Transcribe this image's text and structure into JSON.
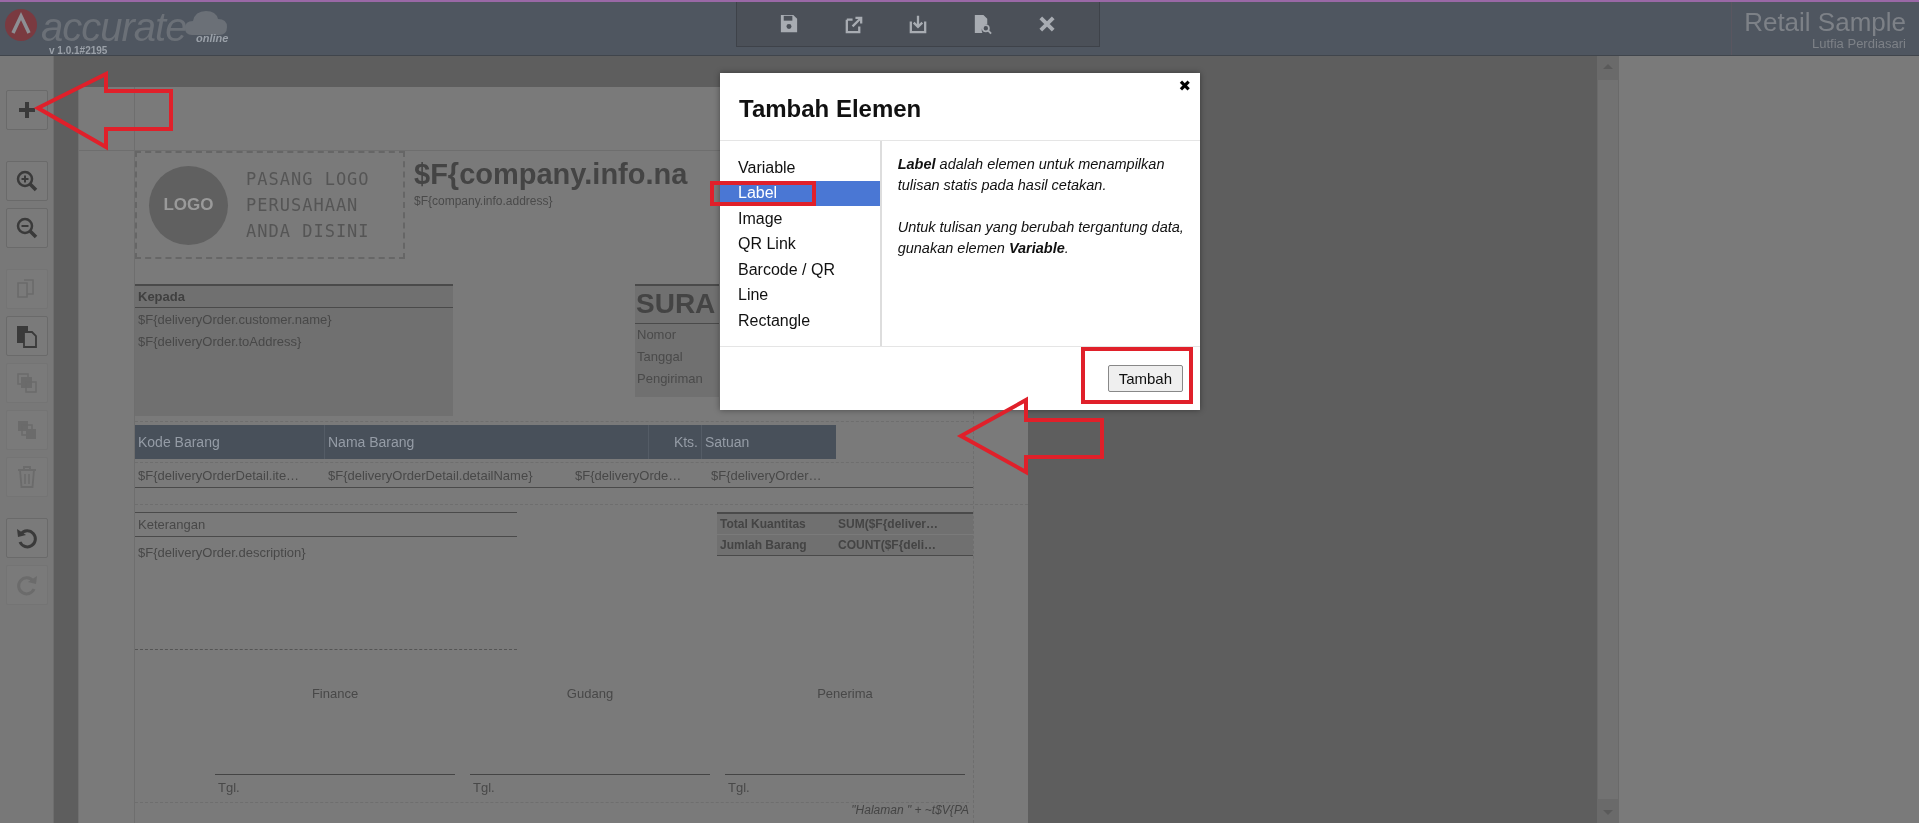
{
  "header": {
    "logo": {
      "name": "accurate",
      "tag": "online",
      "version": "v 1.0.1#2195"
    },
    "company": "Retail Sample",
    "user": "Lutfia Perdiasari"
  },
  "side_tools": [
    {
      "kind": "add",
      "disabled": false
    },
    {
      "kind": "zoom-in",
      "disabled": false
    },
    {
      "kind": "zoom-out",
      "disabled": false
    },
    {
      "kind": "copy",
      "disabled": true
    },
    {
      "kind": "paste",
      "disabled": false
    },
    {
      "kind": "front",
      "disabled": true
    },
    {
      "kind": "back",
      "disabled": true
    },
    {
      "kind": "delete",
      "disabled": true
    },
    {
      "kind": "undo",
      "disabled": false
    },
    {
      "kind": "redo",
      "disabled": true
    }
  ],
  "report": {
    "logo_placeholder": {
      "badge": "LOGO",
      "lines": [
        "PASANG LOGO",
        "PERUSAHAAN",
        "ANDA DISINI"
      ]
    },
    "company_name": "$F{company.info.na",
    "company_address": "$F{company.info.address}",
    "recipient": {
      "heading": "Kepada",
      "lines": [
        "$F{deliveryOrder.customer.name}",
        "$F{deliveryOrder.toAddress}"
      ]
    },
    "doc_title": "SURA",
    "doc_fields": [
      "Nomor",
      "Tanggal",
      "Pengiriman"
    ],
    "table": {
      "columns": [
        {
          "label": "Kode Barang"
        },
        {
          "label": "Nama Barang"
        },
        {
          "label": "Kts."
        },
        {
          "label": "Satuan"
        }
      ],
      "row": [
        "$F{deliveryOrderDetail.ite…",
        "$F{deliveryOrderDetail.detailName}",
        "$F{deliveryOrde…",
        "$F{deliveryOrder…"
      ]
    },
    "notes": {
      "heading": "Keterangan",
      "value": "$F{deliveryOrder.description}"
    },
    "totals": [
      {
        "label": "Total Kuantitas",
        "value": "SUM($F{deliver…"
      },
      {
        "label": "Jumlah Barang",
        "value": "COUNT($F{deli…"
      }
    ],
    "signatures": [
      {
        "title": "Finance",
        "date_label": "Tgl."
      },
      {
        "title": "Gudang",
        "date_label": "Tgl."
      },
      {
        "title": "Penerima",
        "date_label": "Tgl."
      }
    ],
    "footer": "\"Halaman \" + ~t$V{PA"
  },
  "dialog": {
    "title": "Tambah Elemen",
    "close": "✖",
    "items": [
      {
        "label": "Variable",
        "selected": false
      },
      {
        "label": "Label",
        "selected": true
      },
      {
        "label": "Image",
        "selected": false
      },
      {
        "label": "QR Link",
        "selected": false
      },
      {
        "label": "Barcode / QR",
        "selected": false
      },
      {
        "label": "Line",
        "selected": false
      },
      {
        "label": "Rectangle",
        "selected": false
      }
    ],
    "description": [
      "**Label** adalah elemen untuk menampilkan tulisan statis pada hasil cetakan.",
      "Untuk tulisan yang berubah tergantung data, gunakan elemen **Variable**."
    ],
    "button": "Tambah"
  }
}
